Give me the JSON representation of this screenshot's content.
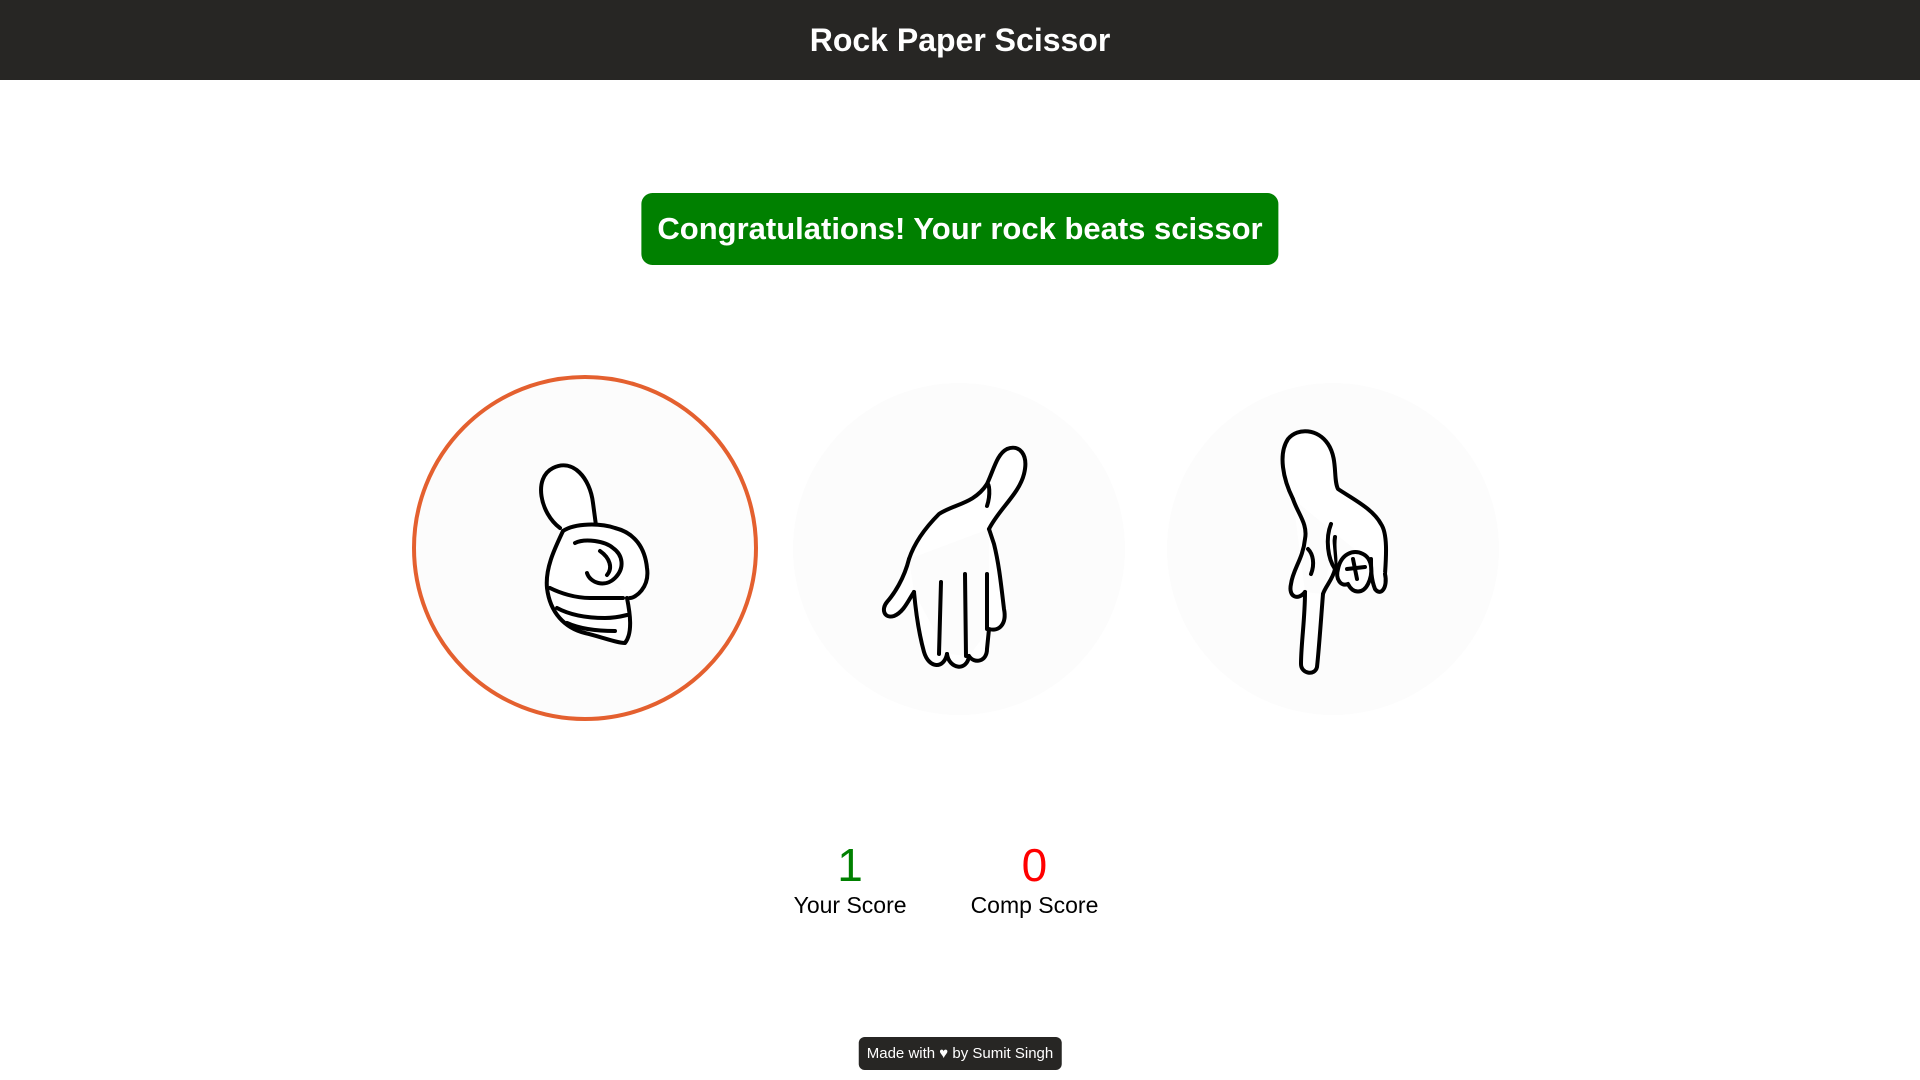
{
  "header": {
    "title": "Rock Paper Scissor"
  },
  "message": {
    "text": "Congratulations! Your rock beats scissor",
    "bg_color": "#008000"
  },
  "choices": [
    {
      "id": "rock",
      "icon": "rock-hand-icon",
      "selected": true
    },
    {
      "id": "paper",
      "icon": "paper-hand-icon",
      "selected": false
    },
    {
      "id": "scissor",
      "icon": "scissor-hand-icon",
      "selected": false
    }
  ],
  "selected_border_color": "#e4602f",
  "scores": {
    "user": {
      "value": "1",
      "label": "Your Score",
      "color": "#008000"
    },
    "comp": {
      "value": "0",
      "label": "Comp Score",
      "color": "#ff0000"
    }
  },
  "footer": {
    "text": "Made with ♥ by Sumit Singh"
  }
}
